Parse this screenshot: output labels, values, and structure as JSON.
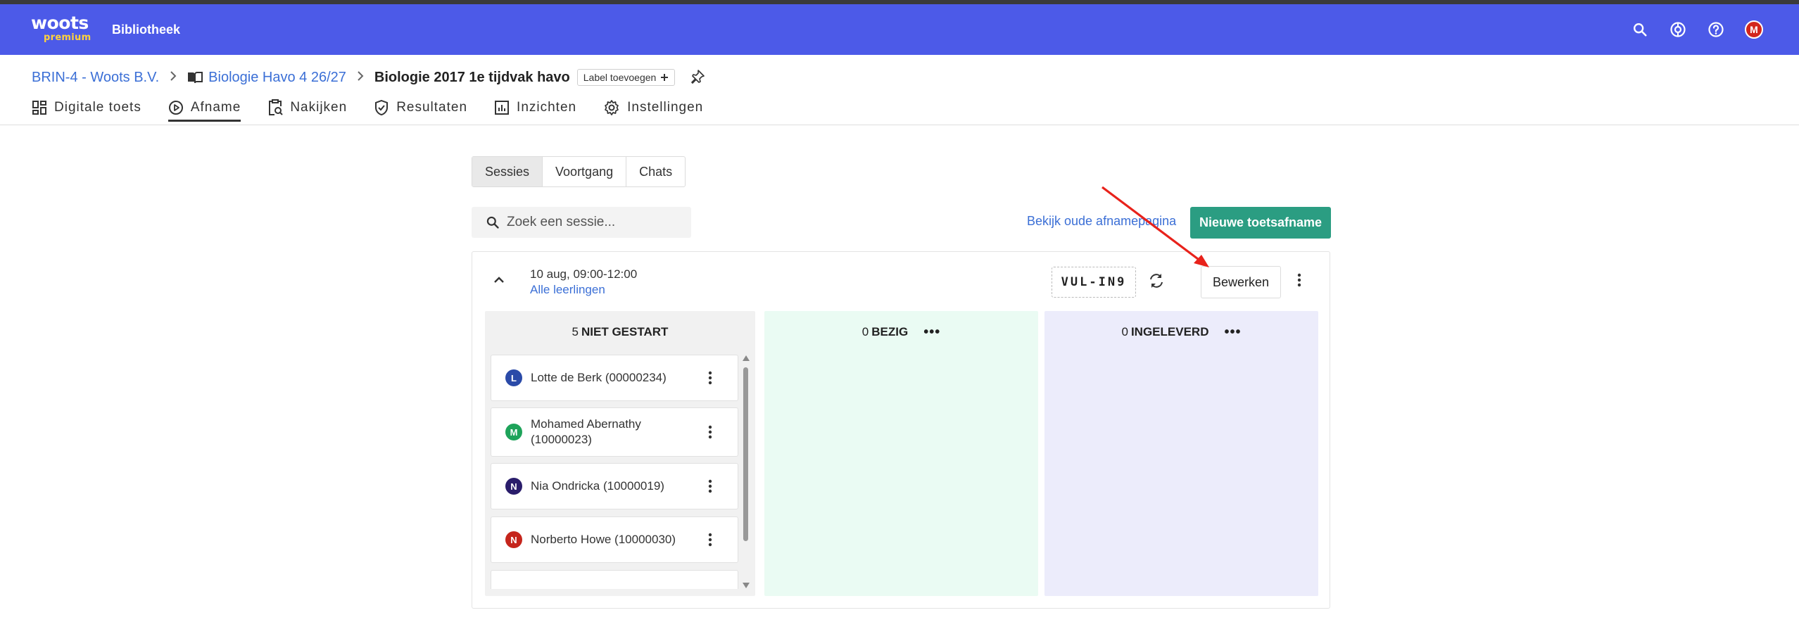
{
  "app": {
    "logo_main": "woots",
    "logo_sub": "premium",
    "library_link": "Bibliotheek",
    "avatar_initial": "M",
    "accent_color": "#4c5ae8"
  },
  "breadcrumb": {
    "org": "BRIN-4 - Woots B.V.",
    "course": "Biologie Havo 4 26/27",
    "assignment": "Biologie 2017 1e tijdvak havo",
    "label_button": "Label toevoegen"
  },
  "tabs": [
    {
      "label": "Digitale toets",
      "icon": "grid-icon"
    },
    {
      "label": "Afname",
      "icon": "play-circle-icon",
      "active": true
    },
    {
      "label": "Nakijken",
      "icon": "clipboard-search-icon"
    },
    {
      "label": "Resultaten",
      "icon": "shield-check-icon"
    },
    {
      "label": "Inzichten",
      "icon": "bar-chart-icon"
    },
    {
      "label": "Instellingen",
      "icon": "gear-icon"
    }
  ],
  "segments": [
    "Sessies",
    "Voortgang",
    "Chats"
  ],
  "search": {
    "placeholder": "Zoek een sessie..."
  },
  "actions": {
    "old_page_link": "Bekijk oude afnamepagina",
    "new_button": "Nieuwe toetsafname"
  },
  "session": {
    "date": "10 aug, 09:00-12:00",
    "group": "Alle leerlingen",
    "code": "VUL-IN9",
    "edit_button": "Bewerken",
    "columns": [
      {
        "count": "5",
        "label": "NIET GESTART",
        "color": "#f1f1f1"
      },
      {
        "count": "0",
        "label": "BEZIG",
        "color": "#eafbf3"
      },
      {
        "count": "0",
        "label": "INGELEVERD",
        "color": "#ececfb"
      }
    ],
    "students": [
      {
        "initial": "L",
        "name": "Lotte de Berk (00000234)",
        "color": "#2a4aa8"
      },
      {
        "initial": "M",
        "name": "Mohamed Abernathy (10000023)",
        "color": "#1ea35a"
      },
      {
        "initial": "N",
        "name": "Nia Ondricka (10000019)",
        "color": "#2a1d6b"
      },
      {
        "initial": "N",
        "name": "Norberto Howe (10000030)",
        "color": "#c5251c"
      }
    ]
  }
}
